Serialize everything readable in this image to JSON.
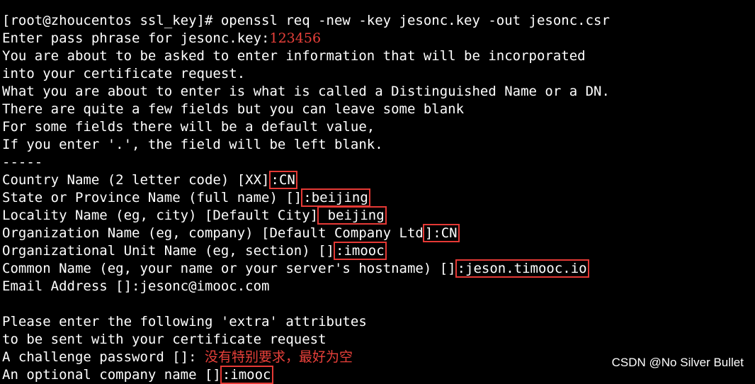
{
  "terminal": {
    "partial_top": "",
    "prompt": "[root@zhoucentos ssl_key]# openssl req -new -key jesonc.key -out jesonc.csr",
    "pass_label": "Enter pass phrase for jesonc.key:",
    "pass_value": "123456",
    "info1": "You are about to be asked to enter information that will be incorporated",
    "info2": "into your certificate request.",
    "info3": "What you are about to enter is what is called a Distinguished Name or a DN.",
    "info4": "There are quite a few fields but you can leave some blank",
    "info5": "For some fields there will be a default value,",
    "info6": "If you enter '.', the field will be left blank.",
    "separator": "-----",
    "country_label": "Country Name (2 letter code) [XX]",
    "country_value": ":CN",
    "state_label": "State or Province Name (full name) []",
    "state_value": ":beijing",
    "locality_label": "Locality Name (eg, city) [Default City]",
    "locality_value": " beijing",
    "org_label_pre": "Organization Name (eg, company) [Default Company Ltd",
    "org_label_bracket": "]",
    "org_value": ":CN",
    "unit_label": "Organizational Unit Name (eg, section) []",
    "unit_value": ":imooc",
    "common_label": "Common Name (eg, your name or your server's hostname) []",
    "common_value": ":jeson.timooc.io",
    "email_line": "Email Address []:jesonc@imooc.com",
    "extra1": "Please enter the following 'extra' attributes",
    "extra2": "to be sent with your certificate request",
    "challenge_label": "A challenge password []:",
    "challenge_note": "没有特别要求，最好为空",
    "optional_label": "An optional company name []",
    "optional_value": ":imooc"
  },
  "watermark": "CSDN @No Silver Bullet",
  "colors": {
    "background": "#000000",
    "text": "#ffffff",
    "annotation_red": "#e8403a",
    "box_red": "#e53935"
  }
}
